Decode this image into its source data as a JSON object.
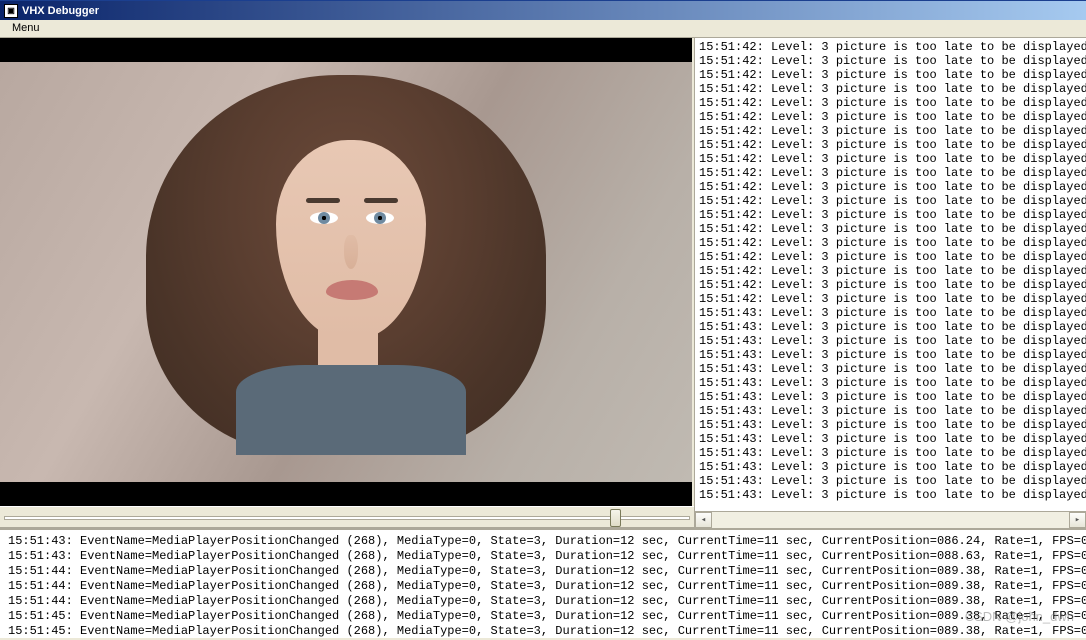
{
  "window": {
    "title": "VHX Debugger",
    "icon_label": "▣"
  },
  "menubar": {
    "menu": "Menu"
  },
  "top_log": {
    "entries": [
      {
        "ts": "15:51:42",
        "msg": "Level: 3 picture is too late to be displayed"
      },
      {
        "ts": "15:51:42",
        "msg": "Level: 3 picture is too late to be displayed"
      },
      {
        "ts": "15:51:42",
        "msg": "Level: 3 picture is too late to be displayed"
      },
      {
        "ts": "15:51:42",
        "msg": "Level: 3 picture is too late to be displayed"
      },
      {
        "ts": "15:51:42",
        "msg": "Level: 3 picture is too late to be displayed"
      },
      {
        "ts": "15:51:42",
        "msg": "Level: 3 picture is too late to be displayed"
      },
      {
        "ts": "15:51:42",
        "msg": "Level: 3 picture is too late to be displayed"
      },
      {
        "ts": "15:51:42",
        "msg": "Level: 3 picture is too late to be displayed"
      },
      {
        "ts": "15:51:42",
        "msg": "Level: 3 picture is too late to be displayed"
      },
      {
        "ts": "15:51:42",
        "msg": "Level: 3 picture is too late to be displayed"
      },
      {
        "ts": "15:51:42",
        "msg": "Level: 3 picture is too late to be displayed"
      },
      {
        "ts": "15:51:42",
        "msg": "Level: 3 picture is too late to be displayed"
      },
      {
        "ts": "15:51:42",
        "msg": "Level: 3 picture is too late to be displayed"
      },
      {
        "ts": "15:51:42",
        "msg": "Level: 3 picture is too late to be displayed"
      },
      {
        "ts": "15:51:42",
        "msg": "Level: 3 picture is too late to be displayed"
      },
      {
        "ts": "15:51:42",
        "msg": "Level: 3 picture is too late to be displayed"
      },
      {
        "ts": "15:51:42",
        "msg": "Level: 3 picture is too late to be displayed"
      },
      {
        "ts": "15:51:42",
        "msg": "Level: 3 picture is too late to be displayed"
      },
      {
        "ts": "15:51:42",
        "msg": "Level: 3 picture is too late to be displayed"
      },
      {
        "ts": "15:51:43",
        "msg": "Level: 3 picture is too late to be displayed"
      },
      {
        "ts": "15:51:43",
        "msg": "Level: 3 picture is too late to be displayed"
      },
      {
        "ts": "15:51:43",
        "msg": "Level: 3 picture is too late to be displayed"
      },
      {
        "ts": "15:51:43",
        "msg": "Level: 3 picture is too late to be displayed"
      },
      {
        "ts": "15:51:43",
        "msg": "Level: 3 picture is too late to be displayed"
      },
      {
        "ts": "15:51:43",
        "msg": "Level: 3 picture is too late to be displayed"
      },
      {
        "ts": "15:51:43",
        "msg": "Level: 3 picture is too late to be displayed"
      },
      {
        "ts": "15:51:43",
        "msg": "Level: 3 picture is too late to be displayed"
      },
      {
        "ts": "15:51:43",
        "msg": "Level: 3 picture is too late to be displayed"
      },
      {
        "ts": "15:51:43",
        "msg": "Level: 3 picture is too late to be displayed"
      },
      {
        "ts": "15:51:43",
        "msg": "Level: 3 picture is too late to be displayed"
      },
      {
        "ts": "15:51:43",
        "msg": "Level: 3 picture is too late to be displayed"
      },
      {
        "ts": "15:51:43",
        "msg": "Level: 3 picture is too late to be displayed"
      },
      {
        "ts": "15:51:43",
        "msg": "Level: 3 picture is too late to be displayed"
      }
    ]
  },
  "bottom_log": {
    "entries": [
      {
        "ts": "15:51:43",
        "event": "MediaPlayerPositionChanged",
        "code": "268",
        "media_type": 0,
        "state": 3,
        "duration_sec": 12,
        "current_time_sec": 11,
        "current_position": "086.24",
        "rate": 1,
        "fps": 0
      },
      {
        "ts": "15:51:43",
        "event": "MediaPlayerPositionChanged",
        "code": "268",
        "media_type": 0,
        "state": 3,
        "duration_sec": 12,
        "current_time_sec": 11,
        "current_position": "088.63",
        "rate": 1,
        "fps": 0
      },
      {
        "ts": "15:51:44",
        "event": "MediaPlayerPositionChanged",
        "code": "268",
        "media_type": 0,
        "state": 3,
        "duration_sec": 12,
        "current_time_sec": 11,
        "current_position": "089.38",
        "rate": 1,
        "fps": 0
      },
      {
        "ts": "15:51:44",
        "event": "MediaPlayerPositionChanged",
        "code": "268",
        "media_type": 0,
        "state": 3,
        "duration_sec": 12,
        "current_time_sec": 11,
        "current_position": "089.38",
        "rate": 1,
        "fps": 0
      },
      {
        "ts": "15:51:44",
        "event": "MediaPlayerPositionChanged",
        "code": "268",
        "media_type": 0,
        "state": 3,
        "duration_sec": 12,
        "current_time_sec": 11,
        "current_position": "089.38",
        "rate": 1,
        "fps": 0
      },
      {
        "ts": "15:51:45",
        "event": "MediaPlayerPositionChanged",
        "code": "268",
        "media_type": 0,
        "state": 3,
        "duration_sec": 12,
        "current_time_sec": 11,
        "current_position": "089.38",
        "rate": 1,
        "fps": 0
      },
      {
        "ts": "15:51:45",
        "event": "MediaPlayerPositionChanged",
        "code": "268",
        "media_type": 0,
        "state": 3,
        "duration_sec": 12,
        "current_time_sec": 11,
        "current_position": "089.38",
        "rate": 1,
        "fps": 0
      }
    ]
  },
  "slider": {
    "position_pct": 88
  },
  "watermark": "CSDN @john_dwh"
}
